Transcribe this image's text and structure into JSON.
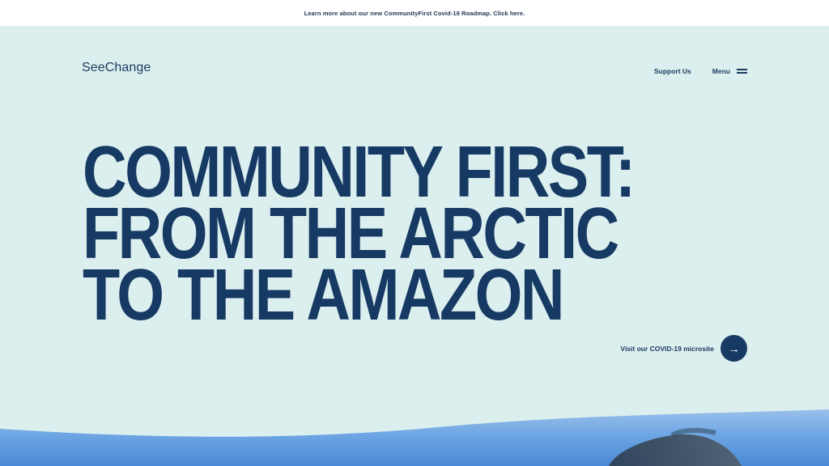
{
  "banner": {
    "text": "Learn more about our new CommunityFirst Covid-19 Roadmap. Click here."
  },
  "header": {
    "logo_text": "SeeChange",
    "support_label": "Support Us",
    "menu_label": "Menu"
  },
  "hero": {
    "headline_lines": [
      "COMMUNITY FIRST:",
      "FROM THE ARCTIC",
      "TO THE AMAZON"
    ],
    "cta_label": "Visit our COVID-19 microsite"
  },
  "colors": {
    "background": "#dcefef",
    "primary": "#173a64",
    "banner_bg": "#ffffff",
    "sky": "#4f8fd6"
  },
  "icons": {
    "menu": "hamburger-icon",
    "cta_arrow": "arrow-right-icon"
  }
}
